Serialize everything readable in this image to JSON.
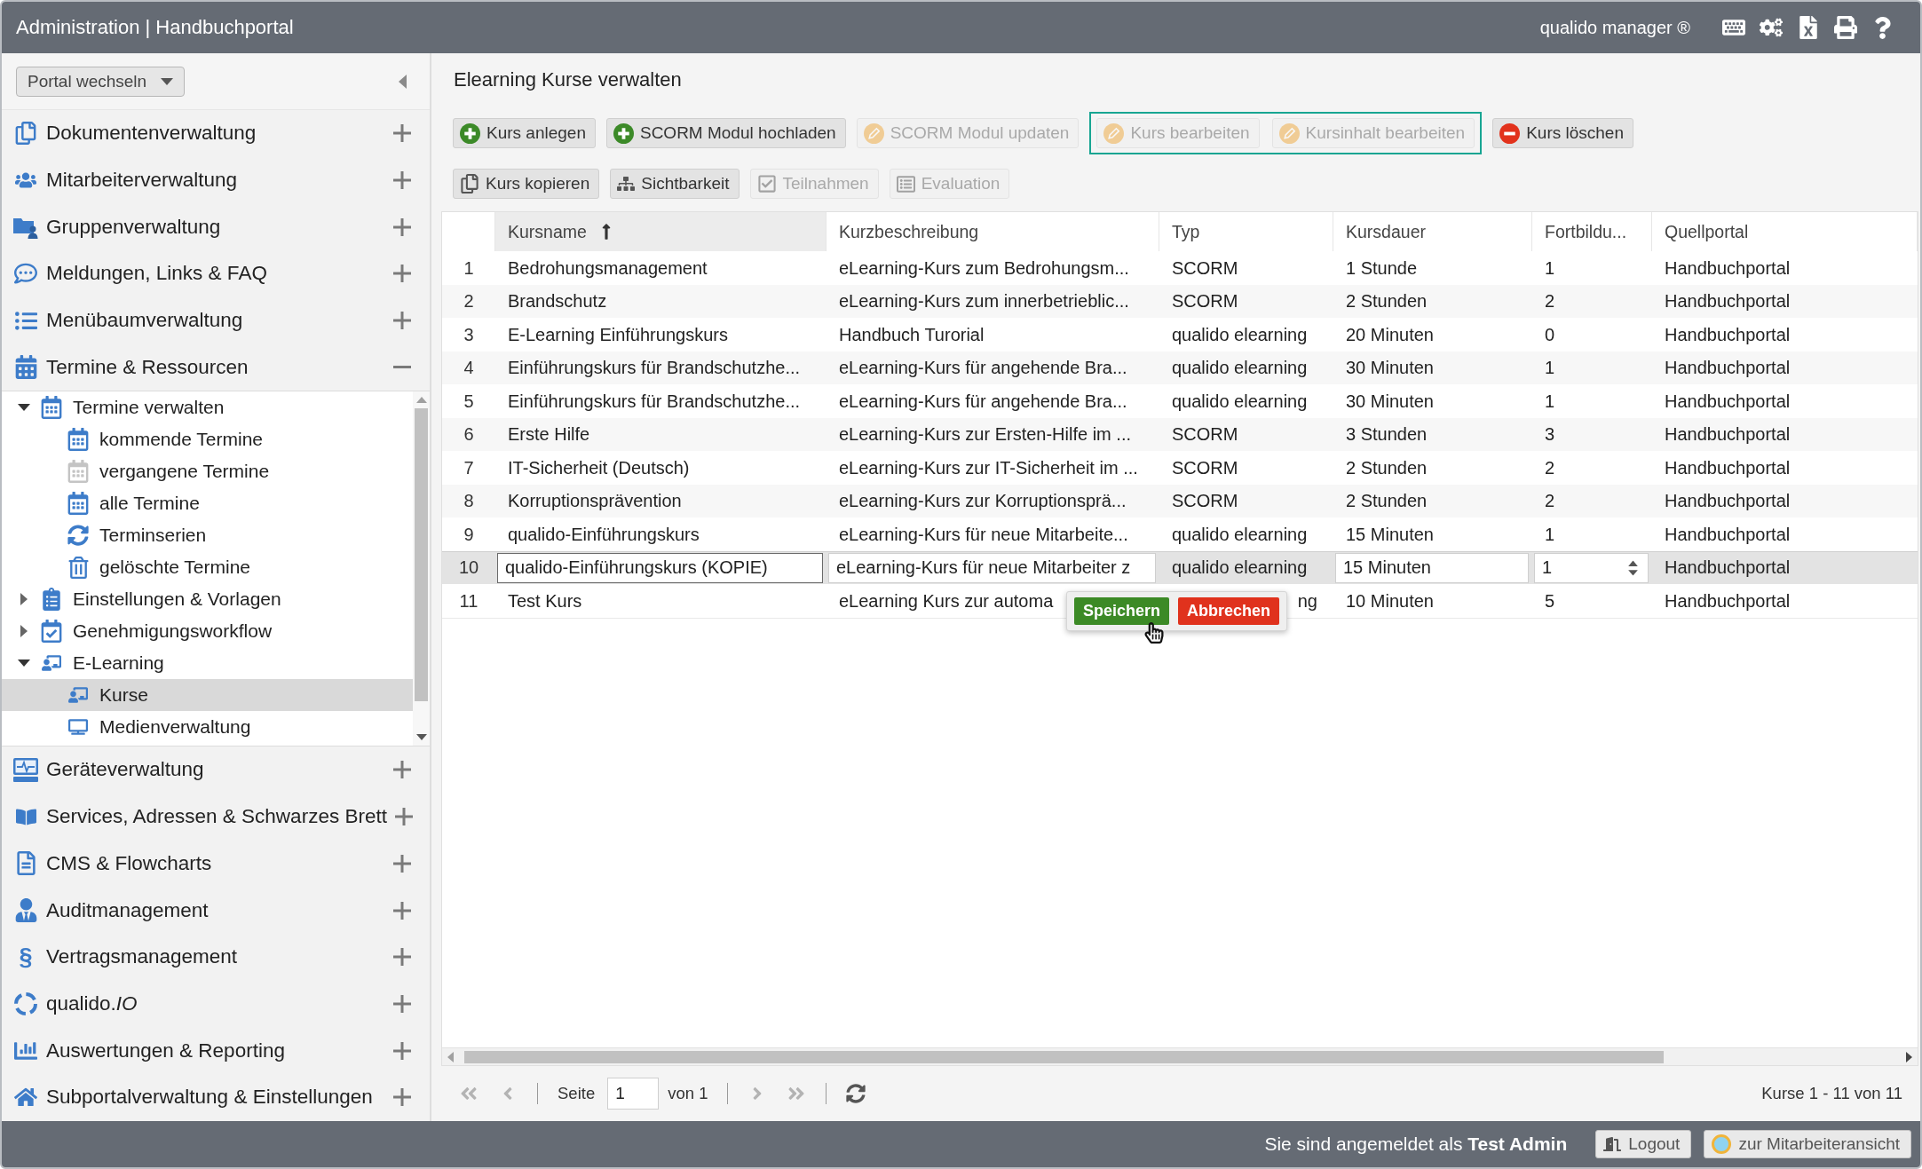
{
  "header": {
    "title": "Administration | Handbuchportal",
    "product": "qualido manager ®"
  },
  "sidebar": {
    "portal_switch": "Portal wechseln",
    "sections": [
      {
        "label": "Dokumentenverwaltung",
        "expanded": false
      },
      {
        "label": "Mitarbeiterverwaltung",
        "expanded": false
      },
      {
        "label": "Gruppenverwaltung",
        "expanded": false
      },
      {
        "label": "Meldungen, Links & FAQ",
        "expanded": false
      },
      {
        "label": "Menübaumverwaltung",
        "expanded": false
      },
      {
        "label": "Termine & Ressourcen",
        "expanded": true,
        "children": [
          {
            "label": "Termine verwalten",
            "expanded": true,
            "selected": false,
            "children": [
              {
                "label": "kommende Termine",
                "selected": false
              },
              {
                "label": "vergangene Termine",
                "selected": false
              },
              {
                "label": "alle Termine",
                "selected": false
              },
              {
                "label": "Terminserien",
                "selected": false
              },
              {
                "label": "gelöschte Termine",
                "selected": false
              }
            ]
          },
          {
            "label": "Einstellungen & Vorlagen",
            "expanded": false,
            "selected": false
          },
          {
            "label": "Genehmigungsworkflow",
            "expanded": false,
            "selected": false
          },
          {
            "label": "E-Learning",
            "expanded": true,
            "selected": false,
            "children": [
              {
                "label": "Kurse",
                "selected": true
              },
              {
                "label": "Medienverwaltung",
                "selected": false
              }
            ]
          }
        ]
      },
      {
        "label": "Geräteverwaltung",
        "expanded": false
      },
      {
        "label": "Services, Adressen & Schwarzes Brett",
        "expanded": false
      },
      {
        "label": "CMS & Flowcharts",
        "expanded": false
      },
      {
        "label": "Auditmanagement",
        "expanded": false
      },
      {
        "label": "Vertragsmanagement",
        "expanded": false,
        "glyph": "§"
      },
      {
        "label": "qualido.*IO*",
        "expanded": false
      },
      {
        "label": "Auswertungen & Reporting",
        "expanded": false
      },
      {
        "label": "Subportalverwaltung & Einstellungen",
        "expanded": false
      }
    ]
  },
  "main": {
    "title": "Elearning Kurse verwalten",
    "toolbar_rows": [
      [
        {
          "kind": "button",
          "label": "Kurs anlegen",
          "disabled": false
        },
        {
          "kind": "button",
          "label": "SCORM Modul hochladen",
          "disabled": false
        },
        {
          "kind": "button",
          "label": "SCORM Modul updaten",
          "disabled": true
        },
        {
          "kind": "group",
          "highlighted": true,
          "buttons": [
            {
              "label": "Kurs bearbeiten",
              "disabled": true
            },
            {
              "label": "Kursinhalt bearbeiten",
              "disabled": true
            }
          ]
        },
        {
          "kind": "button",
          "label": "Kurs löschen",
          "disabled": false
        }
      ],
      [
        {
          "kind": "button",
          "label": "Kurs kopieren",
          "disabled": false
        },
        {
          "kind": "button",
          "label": "Sichtbarkeit",
          "disabled": false
        },
        {
          "kind": "button",
          "label": "Teilnahmen",
          "disabled": true
        },
        {
          "kind": "button",
          "label": "Evaluation",
          "disabled": true
        }
      ]
    ]
  },
  "table": {
    "columns": [
      {
        "label": "Kursname",
        "sorted": true
      },
      {
        "label": "Kurzbeschreibung",
        "sorted": false
      },
      {
        "label": "Typ",
        "sorted": false
      },
      {
        "label": "Kursdauer",
        "sorted": false
      },
      {
        "label": "Fortbildu...",
        "sorted": false
      },
      {
        "label": "Quellportal",
        "sorted": false
      }
    ],
    "rows": [
      {
        "number": "1",
        "editing": false,
        "cells": [
          "Bedrohungsmanagement",
          "eLearning-Kurs zum Bedrohungsm...",
          "SCORM",
          "1 Stunde",
          "1",
          "Handbuchportal"
        ]
      },
      {
        "number": "2",
        "editing": false,
        "cells": [
          "Brandschutz",
          "eLearning-Kurs zum innerbetrieblic...",
          "SCORM",
          "2 Stunden",
          "2",
          "Handbuchportal"
        ]
      },
      {
        "number": "3",
        "editing": false,
        "cells": [
          "E-Learning Einführungskurs",
          "Handbuch Turorial",
          "qualido elearning",
          "20 Minuten",
          "0",
          "Handbuchportal"
        ]
      },
      {
        "number": "4",
        "editing": false,
        "cells": [
          "Einführungskurs für Brandschutzhe...",
          "eLearning-Kurs für angehende Bra...",
          "qualido elearning",
          "30 Minuten",
          "1",
          "Handbuchportal"
        ]
      },
      {
        "number": "5",
        "editing": false,
        "cells": [
          "Einführungskurs für Brandschutzhe...",
          "eLearning-Kurs für angehende Bra...",
          "qualido elearning",
          "30 Minuten",
          "1",
          "Handbuchportal"
        ]
      },
      {
        "number": "6",
        "editing": false,
        "cells": [
          "Erste Hilfe",
          "eLearning-Kurs zur Ersten-Hilfe im ...",
          "SCORM",
          "3 Stunden",
          "3",
          "Handbuchportal"
        ]
      },
      {
        "number": "7",
        "editing": false,
        "cells": [
          "IT-Sicherheit (Deutsch)",
          "eLearning-Kurs zur IT-Sicherheit im ...",
          "SCORM",
          "2 Stunden",
          "2",
          "Handbuchportal"
        ]
      },
      {
        "number": "8",
        "editing": false,
        "cells": [
          "Korruptionsprävention",
          "eLearning-Kurs zur Korruptionsprä...",
          "SCORM",
          "2 Stunden",
          "2",
          "Handbuchportal"
        ]
      },
      {
        "number": "9",
        "editing": false,
        "cells": [
          "qualido-Einführungskurs",
          "eLearning-Kurs für neue Mitarbeite...",
          "qualido elearning",
          "15 Minuten",
          "1",
          "Handbuchportal"
        ]
      },
      {
        "number": "10",
        "editing": true,
        "cells": [
          {
            "kind": "input",
            "value": "qualido-Einführungskurs (KOPIE)",
            "focused": true
          },
          {
            "kind": "input",
            "value": "eLearning-Kurs für neue Mitarbeiter z",
            "focused": false
          },
          {
            "kind": "text",
            "value": "qualido elearning"
          },
          {
            "kind": "input",
            "value": "15 Minuten",
            "focused": false
          },
          {
            "kind": "spinner",
            "value": "1"
          },
          {
            "kind": "text",
            "value": "Handbuchportal"
          }
        ],
        "actions": [
          {
            "kind": "save",
            "label": "Speichern"
          },
          {
            "kind": "cancel",
            "label": "Abbrechen"
          }
        ]
      },
      {
        "number": "11",
        "editing": false,
        "cells": [
          "Test Kurs",
          "eLearning Kurs zur automa",
          {
            "kind": "tail",
            "value": "ng"
          },
          "10 Minuten",
          "5",
          "Handbuchportal"
        ]
      }
    ]
  },
  "pager": {
    "nav": [
      {
        "kind": "first",
        "disabled": true
      },
      {
        "kind": "previous",
        "disabled": true
      },
      {
        "kind": "next",
        "disabled": true
      },
      {
        "kind": "last",
        "disabled": true
      }
    ],
    "page_label": "Seite",
    "page": "1",
    "page_count": "von 1",
    "summary": "Kurse 1 - 11 von 11"
  },
  "footer": {
    "login_text": "Sie sind angemeldet als **Test Admin**",
    "buttons": [
      {
        "kind": "logout",
        "label": "Logout"
      },
      {
        "kind": "employee_view",
        "label": "zur Mitarbeiteransicht"
      }
    ]
  }
}
